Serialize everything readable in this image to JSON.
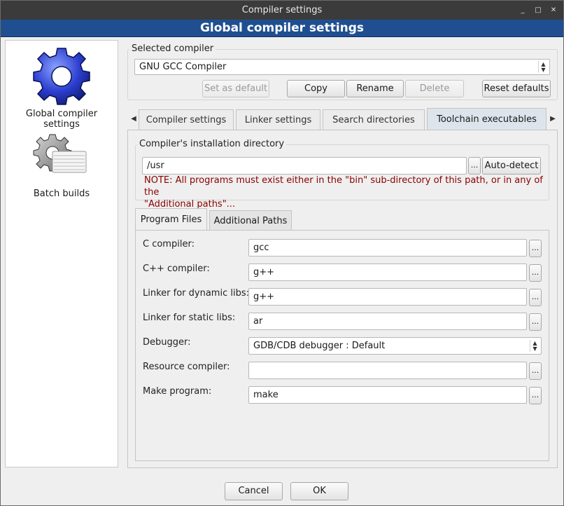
{
  "window": {
    "title": "Compiler settings",
    "controls": [
      "_",
      "□",
      "✕"
    ]
  },
  "banner": {
    "title": "Global compiler settings"
  },
  "sidebar": {
    "items": [
      {
        "label": "Global compiler settings",
        "icon": "gear-icon"
      },
      {
        "label": "Batch builds",
        "icon": "batch-gear-icon"
      }
    ]
  },
  "compiler": {
    "group_label": "Selected compiler",
    "selected": "GNU GCC Compiler",
    "buttons": {
      "set_default": "Set as default",
      "copy": "Copy",
      "rename": "Rename",
      "delete": "Delete",
      "reset": "Reset defaults"
    }
  },
  "tabs": {
    "items": [
      "Compiler settings",
      "Linker settings",
      "Search directories",
      "Toolchain executables"
    ],
    "active": "Toolchain executables"
  },
  "install": {
    "group_label": "Compiler's installation directory",
    "path": "/usr",
    "browse": "...",
    "autodetect": "Auto-detect",
    "note_line1": "NOTE: All programs must exist either in the \"bin\" sub-directory of this path, or in any of the",
    "note_line2": "\"Additional paths\"...",
    "note_color": "#8b0000"
  },
  "subtabs": {
    "items": [
      "Program Files",
      "Additional Paths"
    ],
    "active": "Program Files"
  },
  "programs": {
    "c_compiler": {
      "label": "C compiler:",
      "value": "gcc"
    },
    "cpp_compiler": {
      "label": "C++ compiler:",
      "value": "g++"
    },
    "linker_dynamic": {
      "label": "Linker for dynamic libs:",
      "value": "g++"
    },
    "linker_static": {
      "label": "Linker for static libs:",
      "value": "ar"
    },
    "debugger": {
      "label": "Debugger:",
      "value": "GDB/CDB debugger : Default"
    },
    "resource_compiler": {
      "label": "Resource compiler:",
      "value": ""
    },
    "make": {
      "label": "Make program:",
      "value": "make"
    },
    "browse": "..."
  },
  "footer": {
    "cancel": "Cancel",
    "ok": "OK"
  },
  "colors": {
    "banner": "#1f4f91",
    "titlebar": "#3b3b3b",
    "active_tab": "#dde4ec"
  }
}
